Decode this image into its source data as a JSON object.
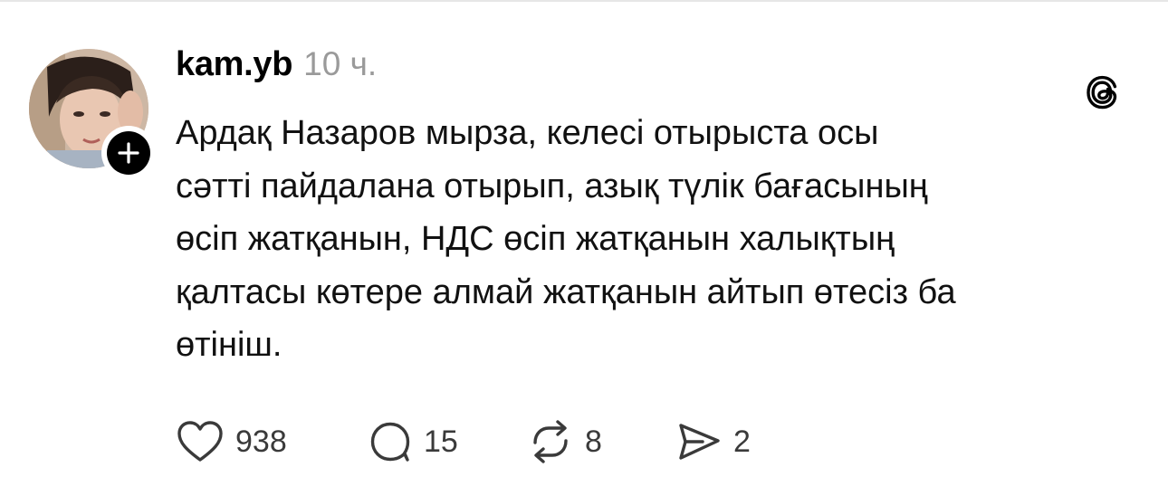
{
  "post": {
    "author": {
      "username": "kam.yb",
      "avatar_icon": "avatar-photo",
      "follow_icon": "plus-icon"
    },
    "timestamp": "10 ч.",
    "app_icon": "threads-logo-icon",
    "text": "Ардақ Назаров мырза, келесі отырыста осы\nсәтті пайдалана отырып, азық түлік бағасының\nөсіп жатқанын, НДС өсіп жатқанын халықтың\nқалтасы көтере алмай жатқанын айтып өтесіз ба\nөтініш.",
    "actions": {
      "likes": "938",
      "replies": "15",
      "reposts": "8",
      "shares": "2"
    }
  },
  "colors": {
    "text": "#111111",
    "muted": "#9a9a9a",
    "divider": "#e6e6e6",
    "badge": "#000000"
  }
}
